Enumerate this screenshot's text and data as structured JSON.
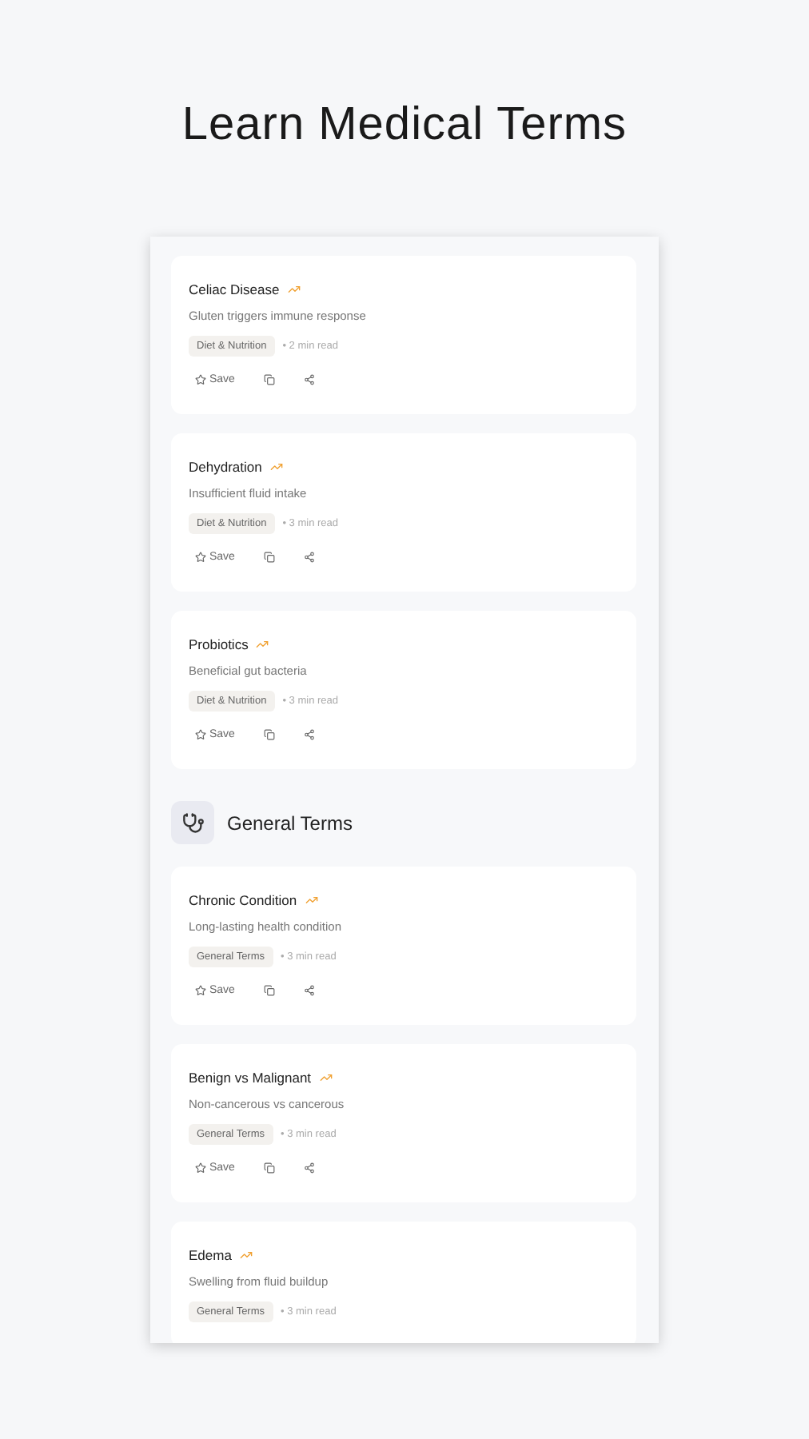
{
  "title": "Learn Medical Terms",
  "sections": [
    {
      "kind": "cards",
      "cards": [
        {
          "title": "Celiac Disease",
          "description": "Gluten triggers immune response",
          "tag": "Diet & Nutrition",
          "read_time": "• 2 min read",
          "actions": {
            "save": "Save"
          }
        },
        {
          "title": "Dehydration",
          "description": "Insufficient fluid intake",
          "tag": "Diet & Nutrition",
          "read_time": "• 3 min read",
          "actions": {
            "save": "Save"
          }
        },
        {
          "title": "Probiotics",
          "description": "Beneficial gut bacteria",
          "tag": "Diet & Nutrition",
          "read_time": "• 3 min read",
          "actions": {
            "save": "Save"
          }
        }
      ]
    },
    {
      "kind": "heading",
      "heading": "General Terms"
    },
    {
      "kind": "cards",
      "cards": [
        {
          "title": "Chronic Condition",
          "description": "Long-lasting health condition",
          "tag": "General Terms",
          "read_time": "• 3 min read",
          "actions": {
            "save": "Save"
          }
        },
        {
          "title": "Benign vs Malignant",
          "description": "Non-cancerous vs cancerous",
          "tag": "General Terms",
          "read_time": "• 3 min read",
          "actions": {
            "save": "Save"
          }
        },
        {
          "title": "Edema",
          "description": "Swelling from fluid buildup",
          "tag": "General Terms",
          "read_time": "• 3 min read"
        }
      ]
    }
  ]
}
